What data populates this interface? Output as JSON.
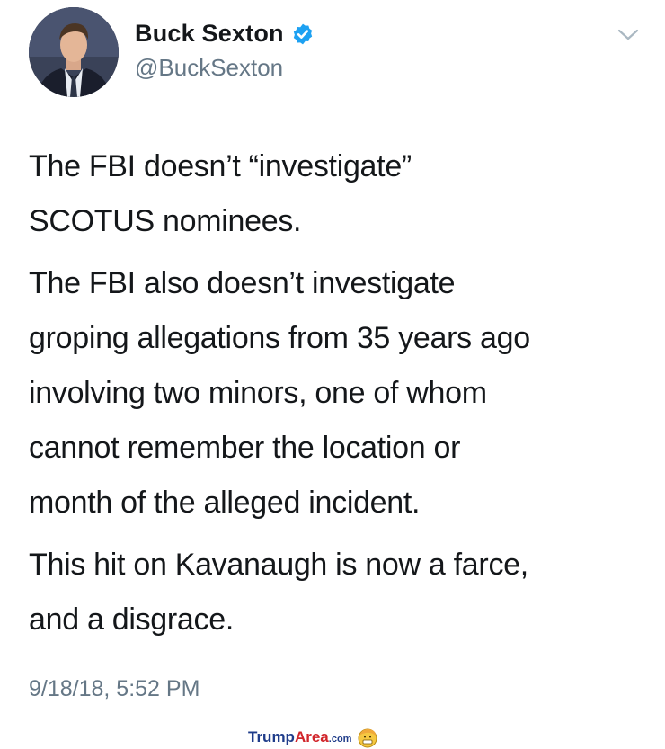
{
  "tweet": {
    "author": {
      "display_name": "Buck Sexton",
      "handle": "@BuckSexton",
      "verified": true,
      "avatar": "profile-photo"
    },
    "paragraphs": [
      {
        "lines": [
          "The FBI doesn’t “investigate”",
          "SCOTUS nominees."
        ]
      },
      {
        "lines": [
          "The FBI also doesn’t investigate",
          "groping allegations from 35 years ago",
          "involving two minors, one of whom",
          "cannot remember the location or",
          "month of the alleged incident."
        ]
      },
      {
        "lines": [
          "This hit on Kavanaugh is now a farce,",
          "and a disgrace."
        ]
      }
    ],
    "timestamp": "9/18/18, 5:52 PM",
    "menu_icon": "chevron-down-icon"
  },
  "watermark": {
    "part1": "Trump",
    "part2": "Area",
    "part3": ".com",
    "icon": "trump-emoji-icon"
  },
  "colors": {
    "text": "#14171a",
    "secondary": "#657786",
    "verified": "#1da1f2"
  }
}
